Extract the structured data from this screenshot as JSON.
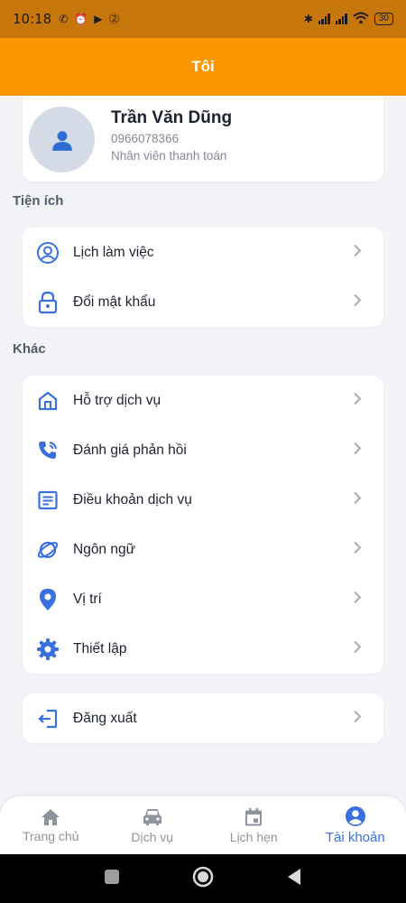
{
  "status_bar": {
    "time": "10:18",
    "battery": "30"
  },
  "app_bar": {
    "title": "Tôi"
  },
  "profile": {
    "name": "Trần Văn Dũng",
    "phone": "0966078366",
    "role": "Nhân viên thanh toán"
  },
  "sections": {
    "utilities": {
      "title": "Tiện ích",
      "items": [
        {
          "label": "Lịch làm việc",
          "icon": "user-circle-icon"
        },
        {
          "label": "Đổi mật khẩu",
          "icon": "lock-icon"
        }
      ]
    },
    "other": {
      "title": "Khác",
      "items": [
        {
          "label": "Hỗ trợ dịch vụ",
          "icon": "home-icon"
        },
        {
          "label": "Đánh giá phản hồi",
          "icon": "phone-call-icon"
        },
        {
          "label": "Điều khoản dịch vụ",
          "icon": "document-icon"
        },
        {
          "label": "Ngôn ngữ",
          "icon": "planet-icon"
        },
        {
          "label": "Vị trí",
          "icon": "location-pin-icon"
        },
        {
          "label": "Thiết lập",
          "icon": "gear-icon"
        }
      ]
    },
    "logout": {
      "label": "Đăng xuất",
      "icon": "logout-icon"
    }
  },
  "bottom_nav": [
    {
      "label": "Trang chủ",
      "icon": "home-icon",
      "active": false
    },
    {
      "label": "Dịch vụ",
      "icon": "car-icon",
      "active": false
    },
    {
      "label": "Lịch hẹn",
      "icon": "calendar-icon",
      "active": false
    },
    {
      "label": "Tài khoản",
      "icon": "account-icon",
      "active": true
    }
  ],
  "colors": {
    "accent": "#fe9601",
    "primary_blue": "#3a6fe0",
    "status_bar": "#c7760c"
  }
}
